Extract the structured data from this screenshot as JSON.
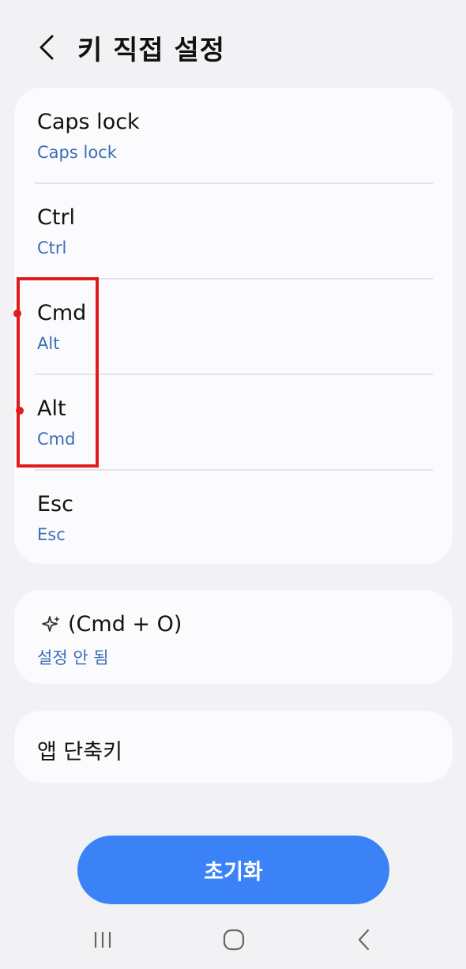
{
  "header": {
    "back_icon": "chevron-left-icon",
    "title": "키 직접 설정"
  },
  "keys": [
    {
      "title": "Caps lock",
      "value": "Caps lock"
    },
    {
      "title": "Ctrl",
      "value": "Ctrl"
    },
    {
      "title": "Cmd",
      "value": "Alt"
    },
    {
      "title": "Alt",
      "value": "Cmd"
    },
    {
      "title": "Esc",
      "value": "Esc"
    }
  ],
  "shortcut": {
    "icon": "sparkle-icon",
    "title": "(Cmd + O)",
    "value": "설정 안 됨"
  },
  "app_shortcuts": {
    "title": "앱 단축키"
  },
  "reset_button": {
    "label": "초기화"
  },
  "colors": {
    "accent": "#3b82f6",
    "subtext": "#3a6eb5",
    "highlight": "#e01b1b",
    "card": "#fbfbfd",
    "background": "#f2f2f4"
  },
  "navbar": {
    "recents_icon": "recents-icon",
    "home_icon": "home-icon",
    "back_icon": "back-icon"
  }
}
